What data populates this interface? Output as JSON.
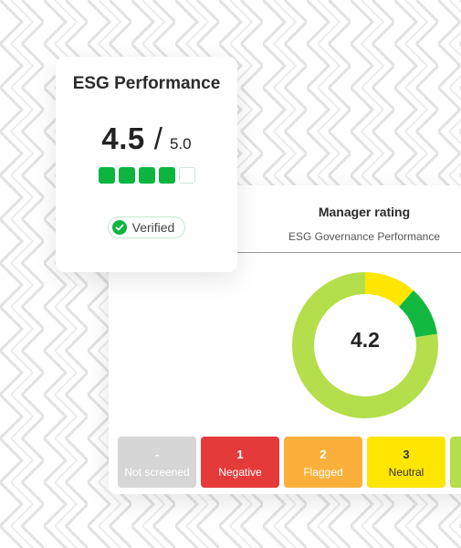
{
  "esg_card": {
    "title": "ESG Performance",
    "score": "4.5",
    "slash": "/",
    "max": "5.0",
    "rating_squares": 4,
    "rating_total": 5,
    "badge": "Verified"
  },
  "manager_card": {
    "title": "Manager rating",
    "subtitle": "ESG Governance Performance",
    "donut_value": "4.2",
    "donut_segments": [
      {
        "fraction": 0.115,
        "color": "#ffe600"
      },
      {
        "fraction": 0.11,
        "color": "#12b83f"
      },
      {
        "fraction": 0.775,
        "color": "#b4de4c"
      }
    ],
    "scale": [
      {
        "num": "-",
        "label": "Not screened",
        "color": "#d6d6d6"
      },
      {
        "num": "1",
        "label": "Negative",
        "color": "#e53a3a"
      },
      {
        "num": "2",
        "label": "Flagged",
        "color": "#fbb03b"
      },
      {
        "num": "3",
        "label": "Neutral",
        "color": "#ffe600"
      },
      {
        "num": "",
        "label": "",
        "color": "#b4de4c"
      }
    ]
  }
}
